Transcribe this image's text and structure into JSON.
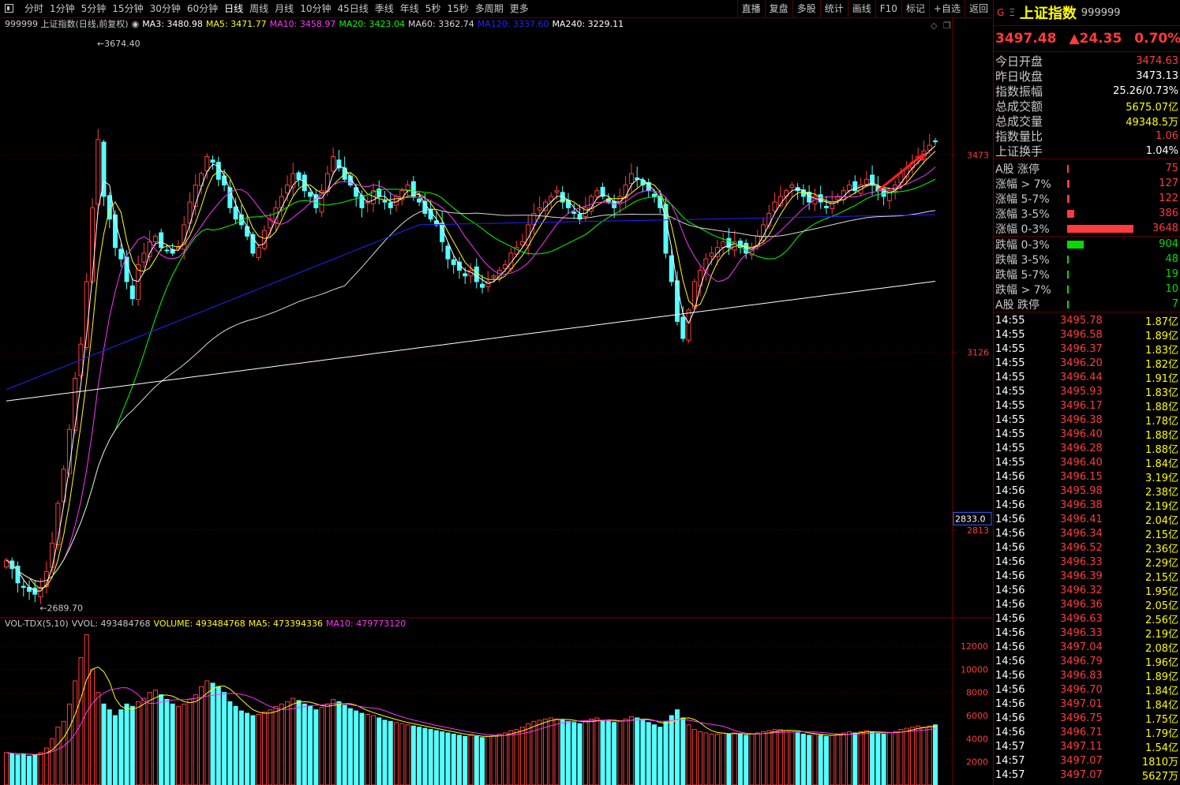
{
  "toolbar": {
    "periods": [
      "分时",
      "1分钟",
      "5分钟",
      "15分钟",
      "30分钟",
      "60分钟",
      "日线",
      "周线",
      "月线",
      "10分钟",
      "45日线",
      "季线",
      "年线",
      "5秒",
      "15秒",
      "多周期",
      "更多"
    ],
    "active_period": "日线",
    "tools": [
      "直播",
      "复盘",
      "多股",
      "统计",
      "画线",
      "F10",
      "标记",
      "+自选",
      "返回"
    ]
  },
  "legend": {
    "header": "999999 上证指数(日线,前复权)",
    "ma3": "MA3: 3480.98",
    "ma5": "MA5: 3471.77",
    "ma10": "MA10: 3458.97",
    "ma20": "MA20: 3423.04",
    "ma60": "MA60: 3362.74",
    "ma120": "MA120: 3337.60",
    "ma240": "MA240: 3229.11"
  },
  "volume_legend": {
    "header": "VOL-TDX(5,10)",
    "vvol": "VVOL: 493484768",
    "volume": "VOLUME: 493484768",
    "ma5": "MA5: 473394336",
    "ma10": "MA10: 479773120"
  },
  "colors": {
    "up": "#ff3b3b",
    "down": "#54ffff",
    "ma3": "#ffffff",
    "ma5": "#ffff00",
    "ma10": "#ff33ff",
    "ma20": "#00ff00",
    "ma60": "#d8d8d8",
    "ma120": "#2222ff",
    "ma240": "#ffffff"
  },
  "chart_data": {
    "type": "candlestick",
    "price_axis": {
      "ylim": [
        2660,
        3690
      ],
      "ticks": [
        3473,
        3126,
        2813
      ],
      "cursor_label": "2833.0"
    },
    "annotations": {
      "high": "3674.40",
      "low": "2689.70"
    },
    "volume_axis": {
      "ylim": [
        0,
        13500
      ],
      "ticks": [
        12000,
        10000,
        8000,
        6000,
        4000,
        2000
      ]
    },
    "ohlc_sample_note": "",
    "closes": [
      2760,
      2745,
      2720,
      2712,
      2705,
      2700,
      2712,
      2740,
      2790,
      2860,
      2920,
      2990,
      3080,
      3140,
      3250,
      3380,
      3500,
      3400,
      3360,
      3310,
      3290,
      3250,
      3220,
      3280,
      3300,
      3320,
      3330,
      3310,
      3305,
      3300,
      3310,
      3350,
      3390,
      3420,
      3440,
      3470,
      3460,
      3430,
      3420,
      3380,
      3360,
      3350,
      3330,
      3300,
      3310,
      3340,
      3360,
      3380,
      3400,
      3420,
      3440,
      3430,
      3410,
      3400,
      3380,
      3410,
      3440,
      3470,
      3450,
      3430,
      3420,
      3400,
      3380,
      3390,
      3410,
      3400,
      3390,
      3380,
      3400,
      3410,
      3420,
      3400,
      3390,
      3370,
      3360,
      3350,
      3320,
      3290,
      3280,
      3270,
      3260,
      3270,
      3250,
      3240,
      3250,
      3260,
      3270,
      3280,
      3300,
      3310,
      3320,
      3350,
      3370,
      3380,
      3390,
      3400,
      3410,
      3390,
      3380,
      3370,
      3360,
      3380,
      3400,
      3410,
      3400,
      3390,
      3380,
      3400,
      3420,
      3440,
      3430,
      3420,
      3410,
      3400,
      3380,
      3300,
      3250,
      3180,
      3150,
      3200,
      3250,
      3270,
      3290,
      3300,
      3310,
      3320,
      3310,
      3320,
      3310,
      3300,
      3310,
      3330,
      3350,
      3370,
      3390,
      3400,
      3410,
      3420,
      3410,
      3400,
      3390,
      3400,
      3390,
      3380,
      3390,
      3400,
      3410,
      3420,
      3410,
      3420,
      3430,
      3420,
      3410,
      3400,
      3410,
      3420,
      3440,
      3450,
      3460,
      3470,
      3480,
      3490,
      3497.48
    ],
    "volumes": [
      2800,
      2700,
      2600,
      2700,
      2500,
      2600,
      2800,
      3200,
      4000,
      5000,
      5500,
      7000,
      9000,
      11000,
      13000,
      10000,
      8000,
      7000,
      6500,
      6000,
      6500,
      7000,
      6800,
      7200,
      7500,
      8000,
      8200,
      7800,
      7400,
      7000,
      6800,
      7000,
      7400,
      7800,
      8500,
      9000,
      8800,
      8500,
      8000,
      7200,
      6800,
      6400,
      6200,
      6000,
      6100,
      6300,
      6500,
      6800,
      7000,
      7200,
      7500,
      7300,
      7000,
      6800,
      6500,
      6700,
      7000,
      7400,
      7200,
      6900,
      6600,
      6400,
      6200,
      6100,
      6000,
      5800,
      5600,
      5500,
      5400,
      5300,
      5200,
      5100,
      5000,
      4900,
      4800,
      4700,
      4600,
      4500,
      4400,
      4300,
      4200,
      4300,
      4200,
      4100,
      4200,
      4300,
      4400,
      4500,
      4700,
      4800,
      5000,
      5300,
      5500,
      5600,
      5700,
      5800,
      5700,
      5600,
      5500,
      5400,
      5300,
      5500,
      5700,
      5800,
      5600,
      5500,
      5400,
      5500,
      5700,
      5900,
      5800,
      5600,
      5400,
      5200,
      5000,
      5500,
      6000,
      6500,
      5800,
      5200,
      4800,
      4600,
      4500,
      4400,
      4400,
      4500,
      4400,
      4500,
      4400,
      4300,
      4400,
      4500,
      4600,
      4700,
      4800,
      4800,
      4700,
      4600,
      4500,
      4400,
      4300,
      4400,
      4300,
      4200,
      4300,
      4400,
      4500,
      4600,
      4500,
      4600,
      4700,
      4600,
      4500,
      4400,
      4500,
      4600,
      4800,
      4900,
      5000,
      5100,
      5000,
      5100,
      5200
    ]
  },
  "sidebar": {
    "g_icon": "G",
    "eq_icon": "Ξ",
    "name": "上证指数",
    "code": "999999",
    "last": "3497.48",
    "change": "▲24.35",
    "pct": "0.70%",
    "stats": [
      {
        "k": "今日开盘",
        "v": "3474.63",
        "c": "red"
      },
      {
        "k": "昨日收盘",
        "v": "3473.13",
        "c": "white"
      },
      {
        "k": "指数振幅",
        "v": "25.26/0.73%",
        "c": "white"
      },
      {
        "k": "总成交额",
        "v": "5675.07亿",
        "c": "yel"
      },
      {
        "k": "总成交量",
        "v": "49348.5万",
        "c": "yel"
      },
      {
        "k": "指数量比",
        "v": "1.06",
        "c": "red"
      },
      {
        "k": "上证换手",
        "v": "1.04%",
        "c": "white"
      }
    ],
    "dist": [
      {
        "k": "A股 涨停",
        "v": "75",
        "c": "#ff3b3b",
        "frac": 0.02
      },
      {
        "k": "涨幅 > 7%",
        "v": "127",
        "c": "#ff3b3b",
        "frac": 0.035
      },
      {
        "k": "涨幅 5-7%",
        "v": "122",
        "c": "#ff3b3b",
        "frac": 0.034
      },
      {
        "k": "涨幅 3-5%",
        "v": "386",
        "c": "#ff3b3b",
        "frac": 0.106
      },
      {
        "k": "涨幅 0-3%",
        "v": "3648",
        "c": "#ff3b3b",
        "frac": 1.0
      },
      {
        "k": "跌幅 0-3%",
        "v": "904",
        "c": "#00dd00",
        "frac": 0.248
      },
      {
        "k": "跌幅 3-5%",
        "v": "48",
        "c": "#00dd00",
        "frac": 0.013
      },
      {
        "k": "跌幅 5-7%",
        "v": "19",
        "c": "#00dd00",
        "frac": 0.005
      },
      {
        "k": "跌幅 > 7%",
        "v": "10",
        "c": "#00dd00",
        "frac": 0.003
      },
      {
        "k": "A股 跌停",
        "v": "7",
        "c": "#00dd00",
        "frac": 0.002
      }
    ],
    "ticks": [
      {
        "t": "14:55",
        "p": "3495.78",
        "a": "1.87亿"
      },
      {
        "t": "14:55",
        "p": "3496.58",
        "a": "1.89亿"
      },
      {
        "t": "14:55",
        "p": "3496.37",
        "a": "1.83亿"
      },
      {
        "t": "14:55",
        "p": "3496.20",
        "a": "1.82亿"
      },
      {
        "t": "14:55",
        "p": "3496.44",
        "a": "1.91亿"
      },
      {
        "t": "14:55",
        "p": "3495.93",
        "a": "1.83亿"
      },
      {
        "t": "14:55",
        "p": "3496.17",
        "a": "1.88亿"
      },
      {
        "t": "14:55",
        "p": "3496.38",
        "a": "1.78亿"
      },
      {
        "t": "14:55",
        "p": "3496.40",
        "a": "1.88亿"
      },
      {
        "t": "14:55",
        "p": "3496.28",
        "a": "1.88亿"
      },
      {
        "t": "14:55",
        "p": "3496.40",
        "a": "1.84亿"
      },
      {
        "t": "14:56",
        "p": "3496.15",
        "a": "3.19亿"
      },
      {
        "t": "14:56",
        "p": "3495.98",
        "a": "2.38亿"
      },
      {
        "t": "14:56",
        "p": "3496.38",
        "a": "2.19亿"
      },
      {
        "t": "14:56",
        "p": "3496.41",
        "a": "2.04亿"
      },
      {
        "t": "14:56",
        "p": "3496.34",
        "a": "2.15亿"
      },
      {
        "t": "14:56",
        "p": "3496.52",
        "a": "2.36亿"
      },
      {
        "t": "14:56",
        "p": "3496.33",
        "a": "2.29亿"
      },
      {
        "t": "14:56",
        "p": "3496.39",
        "a": "2.15亿"
      },
      {
        "t": "14:56",
        "p": "3496.32",
        "a": "1.95亿"
      },
      {
        "t": "14:56",
        "p": "3496.36",
        "a": "2.05亿"
      },
      {
        "t": "14:56",
        "p": "3496.63",
        "a": "2.56亿"
      },
      {
        "t": "14:56",
        "p": "3496.33",
        "a": "2.19亿"
      },
      {
        "t": "14:56",
        "p": "3497.04",
        "a": "2.08亿"
      },
      {
        "t": "14:56",
        "p": "3496.79",
        "a": "1.96亿"
      },
      {
        "t": "14:56",
        "p": "3496.83",
        "a": "1.89亿"
      },
      {
        "t": "14:56",
        "p": "3496.70",
        "a": "1.84亿"
      },
      {
        "t": "14:56",
        "p": "3497.01",
        "a": "1.84亿"
      },
      {
        "t": "14:56",
        "p": "3496.75",
        "a": "1.75亿"
      },
      {
        "t": "14:56",
        "p": "3496.71",
        "a": "1.79亿"
      },
      {
        "t": "14:57",
        "p": "3497.11",
        "a": "1.54亿"
      },
      {
        "t": "14:57",
        "p": "3497.07",
        "a": "1810万"
      },
      {
        "t": "14:57",
        "p": "3497.07",
        "a": "5627万"
      }
    ]
  }
}
